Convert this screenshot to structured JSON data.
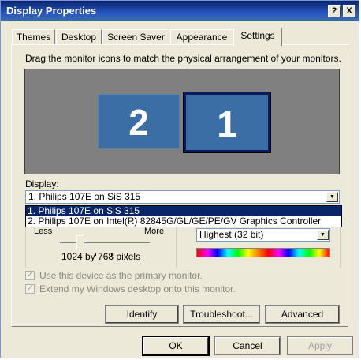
{
  "window": {
    "title": "Display Properties"
  },
  "titlebar_buttons": {
    "help": "?",
    "close": "X"
  },
  "tabs": [
    {
      "label": "Themes"
    },
    {
      "label": "Desktop"
    },
    {
      "label": "Screen Saver"
    },
    {
      "label": "Appearance"
    },
    {
      "label": "Settings"
    }
  ],
  "settings": {
    "instruction": "Drag the monitor icons to match the physical arrangement of your monitors.",
    "monitors": [
      {
        "number": "2"
      },
      {
        "number": "1"
      }
    ],
    "display_label": "Display:",
    "display_selected": "1. Philips 107E on SiS 315",
    "display_options": [
      "1. Philips 107E on SiS 315",
      "2. Philips 107E on Intel(R) 82845G/GL/GE/PE/GV Graphics Controller"
    ],
    "resolution": {
      "less": "Less",
      "more": "More",
      "value": "1024 by 768 pixels"
    },
    "color_quality": {
      "value": "Highest (32 bit)"
    },
    "checkbox_primary": "Use this device as the primary monitor.",
    "checkbox_extend": "Extend my Windows desktop onto this monitor.",
    "buttons": {
      "identify": "Identify",
      "troubleshoot": "Troubleshoot...",
      "advanced": "Advanced"
    }
  },
  "footer": {
    "ok": "OK",
    "cancel": "Cancel",
    "apply": "Apply"
  }
}
